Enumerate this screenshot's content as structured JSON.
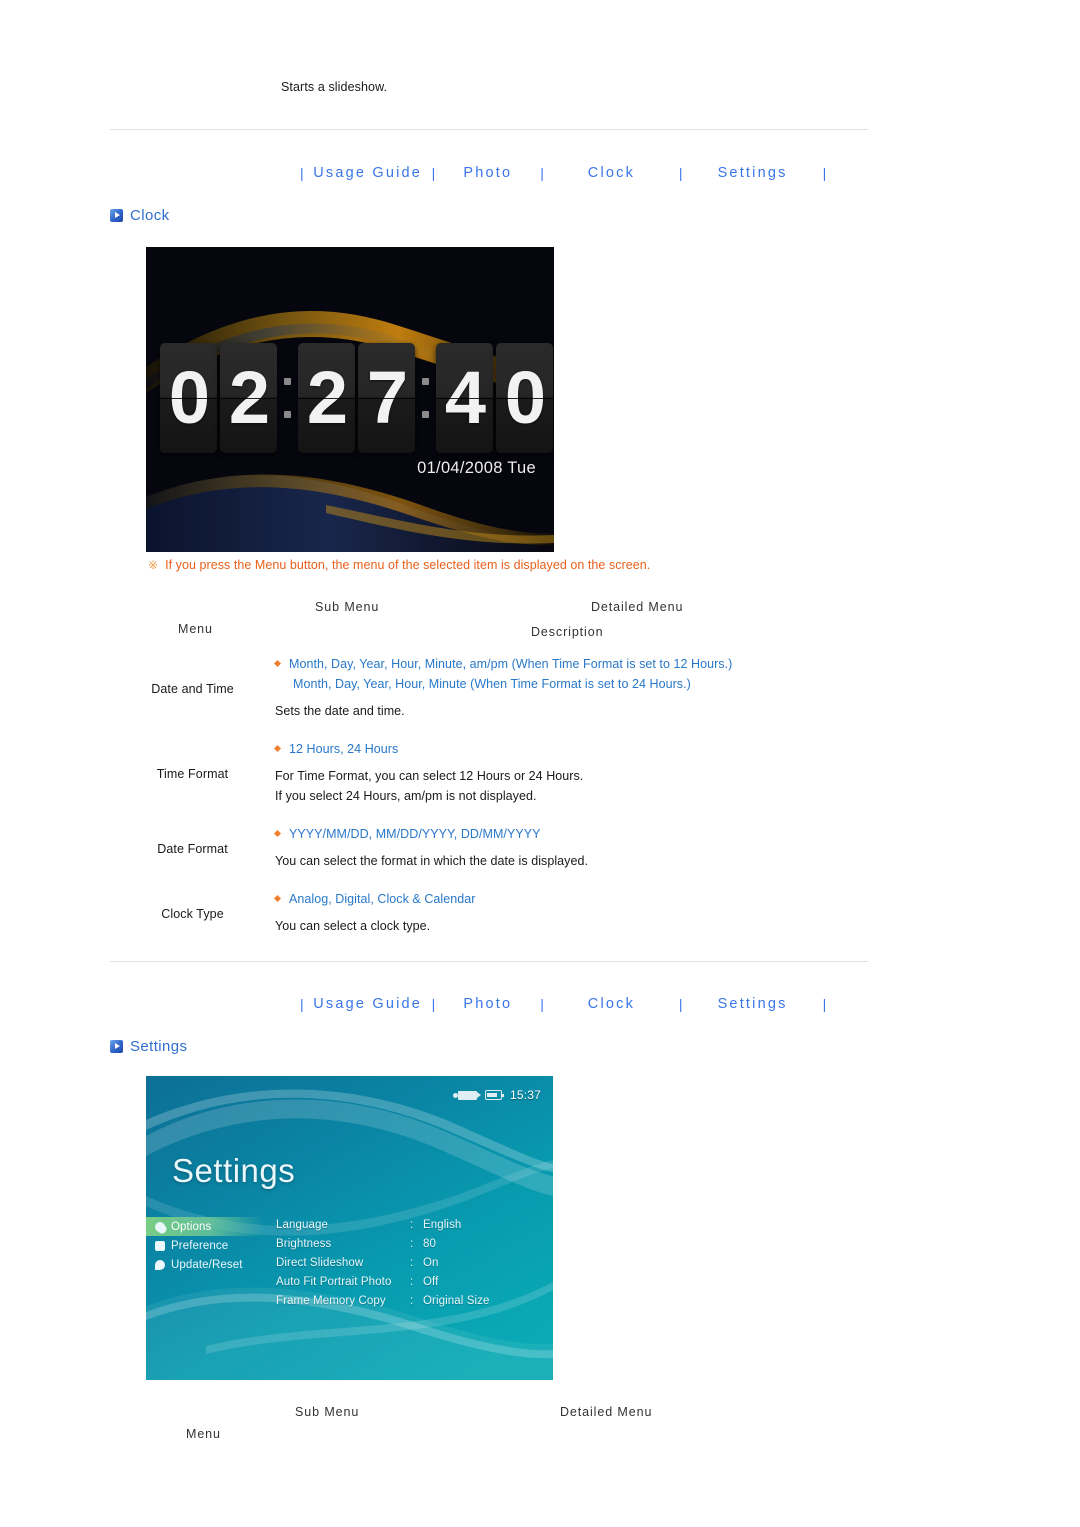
{
  "intro": {
    "text": "Starts a slideshow."
  },
  "nav": {
    "separator": "|",
    "items": [
      {
        "label": "Usage Guide"
      },
      {
        "label": "Photo"
      },
      {
        "label": "Clock"
      },
      {
        "label": "Settings"
      }
    ]
  },
  "clock_section": {
    "heading": "Clock",
    "icon": "play-square-icon",
    "device": {
      "name": "digital-flip-clock-screen",
      "digits": [
        "0",
        "2",
        "2",
        "7",
        "4",
        "0"
      ],
      "time_display": "02:27:40",
      "date": "01/04/2008 Tue"
    },
    "note": {
      "mark": "※",
      "text": "If you press the Menu button, the menu of the selected item is displayed on the screen."
    },
    "table": {
      "headers": {
        "menu": "Menu",
        "sub_menu": "Sub Menu",
        "detailed_menu": "Detailed Menu",
        "description": "Description"
      },
      "rows": [
        {
          "menu": "Date and Time",
          "options": [
            "Month, Day, Year, Hour, Minute, am/pm (When Time Format is set to 12 Hours.)",
            "Month, Day, Year, Hour, Minute (When Time Format is set to 24 Hours.)"
          ],
          "descriptions": [
            "Sets the date and time."
          ]
        },
        {
          "menu": "Time Format",
          "options": [
            "12 Hours, 24 Hours"
          ],
          "descriptions": [
            "For Time Format, you can select 12 Hours or 24 Hours.",
            "If you select 24 Hours, am/pm is not displayed."
          ]
        },
        {
          "menu": "Date Format",
          "options": [
            "YYYY/MM/DD, MM/DD/YYYY, DD/MM/YYYY"
          ],
          "descriptions": [
            "You can select the format in which the date is displayed."
          ]
        },
        {
          "menu": "Clock Type",
          "options": [
            "Analog, Digital, Clock & Calendar"
          ],
          "descriptions": [
            "You can select a clock type."
          ]
        }
      ]
    }
  },
  "settings_section": {
    "heading": "Settings",
    "icon": "play-square-icon",
    "device": {
      "name": "settings-menu-screen",
      "title": "Settings",
      "status_bar": {
        "usb_icon": "usb-icon",
        "battery_icon": "battery-icon",
        "time": "15:37"
      },
      "left_menu": [
        {
          "label": "Options",
          "icon": "magnifier-icon",
          "selected": true
        },
        {
          "label": "Preference",
          "icon": "preference-icon",
          "selected": false
        },
        {
          "label": "Update/Reset",
          "icon": "update-icon",
          "selected": false
        }
      ],
      "rows": [
        {
          "label": "Language",
          "colon": ":",
          "value": "English"
        },
        {
          "label": "Brightness",
          "colon": ":",
          "value": "80"
        },
        {
          "label": "Direct Slideshow",
          "colon": ":",
          "value": "On"
        },
        {
          "label": "Auto Fit Portrait Photo",
          "colon": ":",
          "value": "Off"
        },
        {
          "label": "Frame Memory Copy",
          "colon": ":",
          "value": "Original Size"
        }
      ]
    },
    "table": {
      "headers": {
        "menu": "Menu",
        "sub_menu": "Sub Menu",
        "detailed_menu": "Detailed Menu"
      }
    }
  }
}
